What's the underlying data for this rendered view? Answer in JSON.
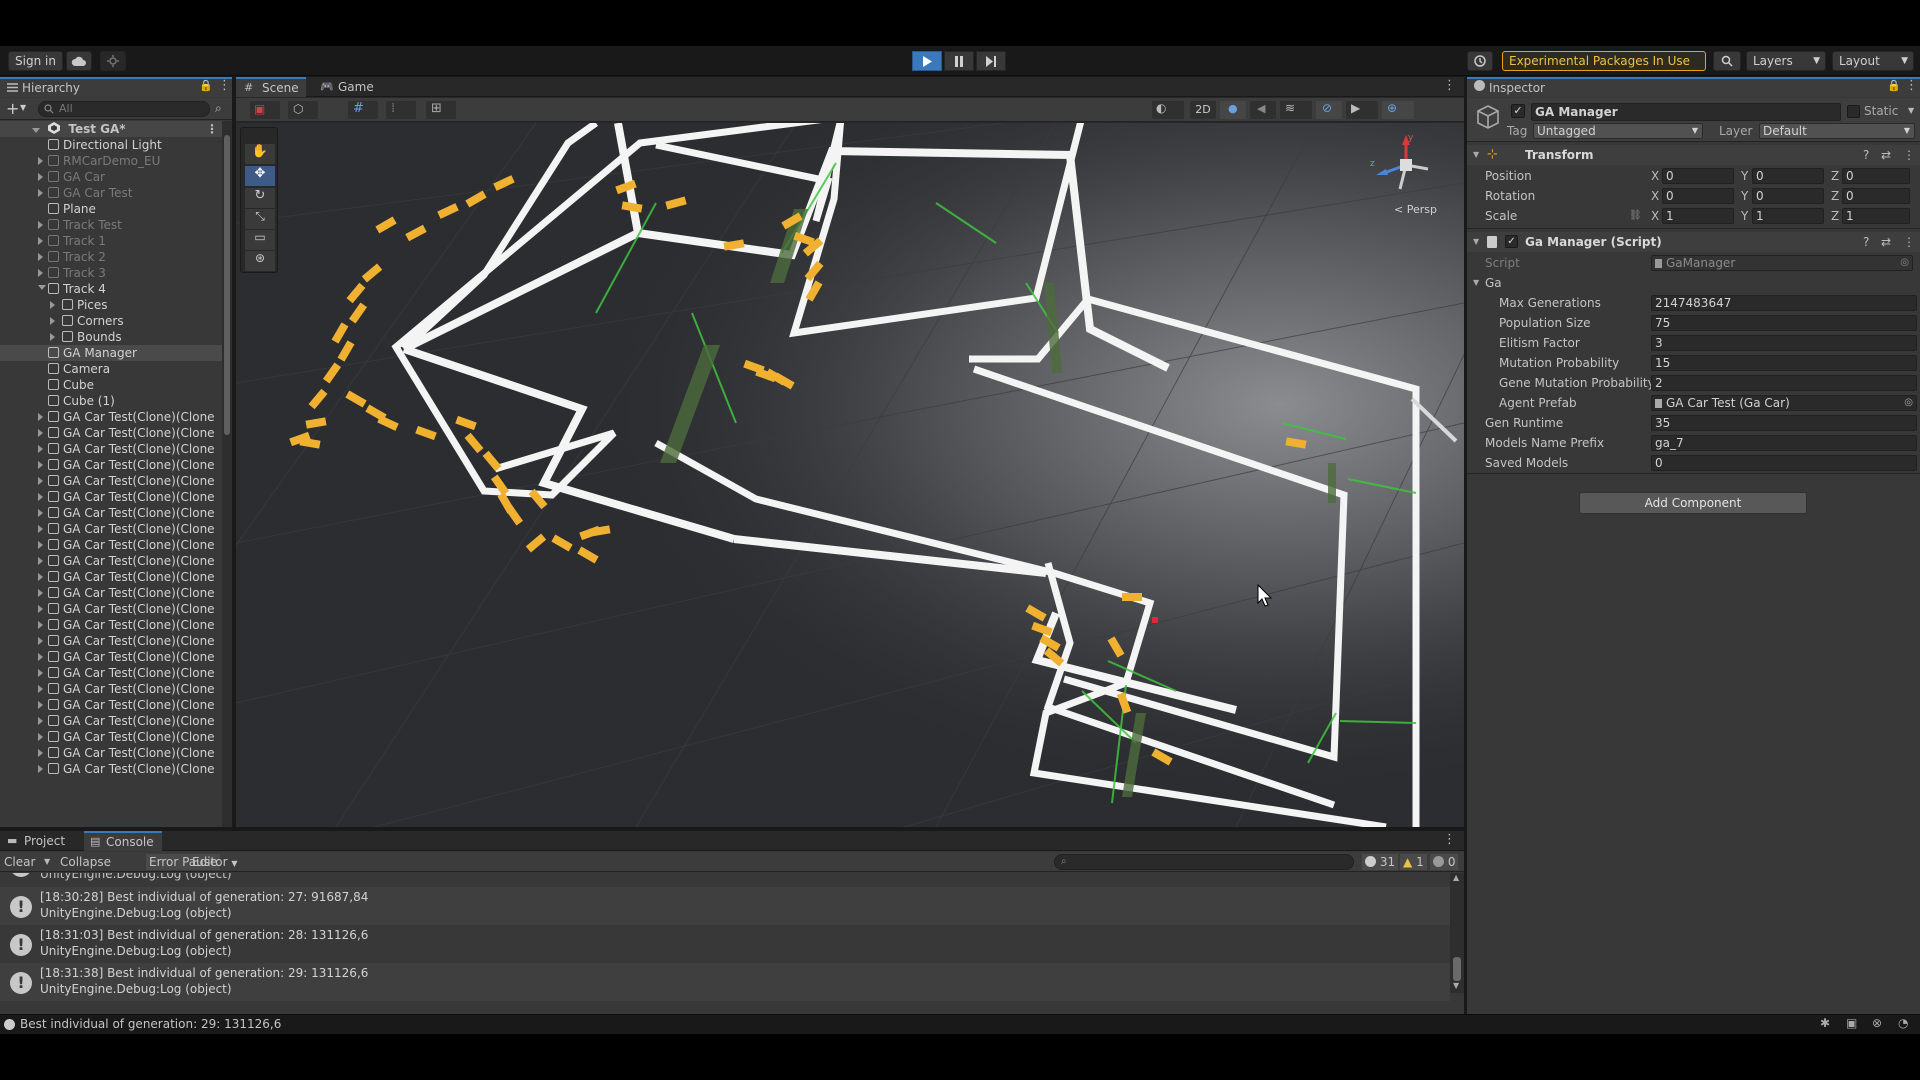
{
  "toolbar": {
    "sign_in": "Sign in",
    "experimental": "Experimental Packages In Use",
    "layers": "Layers",
    "layout": "Layout"
  },
  "hierarchy": {
    "tab": "Hierarchy",
    "search_placeholder": "All",
    "root": "Test GA*",
    "items": [
      {
        "label": "Directional Light",
        "dim": false,
        "indent": 1,
        "arrow": "none"
      },
      {
        "label": "RMCarDemo_EU",
        "dim": true,
        "indent": 1,
        "arrow": "closed"
      },
      {
        "label": "GA Car",
        "dim": true,
        "indent": 1,
        "arrow": "closed"
      },
      {
        "label": "GA Car Test",
        "dim": true,
        "indent": 1,
        "arrow": "closed"
      },
      {
        "label": "Plane",
        "dim": false,
        "indent": 1,
        "arrow": "none"
      },
      {
        "label": "Track Test",
        "dim": true,
        "indent": 1,
        "arrow": "closed"
      },
      {
        "label": "Track 1",
        "dim": true,
        "indent": 1,
        "arrow": "closed"
      },
      {
        "label": "Track 2",
        "dim": true,
        "indent": 1,
        "arrow": "closed"
      },
      {
        "label": "Track 3",
        "dim": true,
        "indent": 1,
        "arrow": "closed"
      },
      {
        "label": "Track 4",
        "dim": false,
        "indent": 1,
        "arrow": "open"
      },
      {
        "label": "Pices",
        "dim": false,
        "indent": 2,
        "arrow": "closed"
      },
      {
        "label": "Corners",
        "dim": false,
        "indent": 2,
        "arrow": "closed"
      },
      {
        "label": "Bounds",
        "dim": false,
        "indent": 2,
        "arrow": "closed"
      },
      {
        "label": "GA Manager",
        "dim": false,
        "indent": 1,
        "arrow": "none",
        "selected": true
      },
      {
        "label": "Camera",
        "dim": false,
        "indent": 1,
        "arrow": "none"
      },
      {
        "label": "Cube",
        "dim": false,
        "indent": 1,
        "arrow": "none"
      },
      {
        "label": "Cube (1)",
        "dim": false,
        "indent": 1,
        "arrow": "none"
      },
      {
        "label": "GA Car Test(Clone)(Clone",
        "dim": false,
        "indent": 1,
        "arrow": "closed"
      },
      {
        "label": "GA Car Test(Clone)(Clone",
        "dim": false,
        "indent": 1,
        "arrow": "closed"
      },
      {
        "label": "GA Car Test(Clone)(Clone",
        "dim": false,
        "indent": 1,
        "arrow": "closed"
      },
      {
        "label": "GA Car Test(Clone)(Clone",
        "dim": false,
        "indent": 1,
        "arrow": "closed"
      },
      {
        "label": "GA Car Test(Clone)(Clone",
        "dim": false,
        "indent": 1,
        "arrow": "closed"
      },
      {
        "label": "GA Car Test(Clone)(Clone",
        "dim": false,
        "indent": 1,
        "arrow": "closed"
      },
      {
        "label": "GA Car Test(Clone)(Clone",
        "dim": false,
        "indent": 1,
        "arrow": "closed"
      },
      {
        "label": "GA Car Test(Clone)(Clone",
        "dim": false,
        "indent": 1,
        "arrow": "closed"
      },
      {
        "label": "GA Car Test(Clone)(Clone",
        "dim": false,
        "indent": 1,
        "arrow": "closed"
      },
      {
        "label": "GA Car Test(Clone)(Clone",
        "dim": false,
        "indent": 1,
        "arrow": "closed"
      },
      {
        "label": "GA Car Test(Clone)(Clone",
        "dim": false,
        "indent": 1,
        "arrow": "closed"
      },
      {
        "label": "GA Car Test(Clone)(Clone",
        "dim": false,
        "indent": 1,
        "arrow": "closed"
      },
      {
        "label": "GA Car Test(Clone)(Clone",
        "dim": false,
        "indent": 1,
        "arrow": "closed"
      },
      {
        "label": "GA Car Test(Clone)(Clone",
        "dim": false,
        "indent": 1,
        "arrow": "closed"
      },
      {
        "label": "GA Car Test(Clone)(Clone",
        "dim": false,
        "indent": 1,
        "arrow": "closed"
      },
      {
        "label": "GA Car Test(Clone)(Clone",
        "dim": false,
        "indent": 1,
        "arrow": "closed"
      },
      {
        "label": "GA Car Test(Clone)(Clone",
        "dim": false,
        "indent": 1,
        "arrow": "closed"
      },
      {
        "label": "GA Car Test(Clone)(Clone",
        "dim": false,
        "indent": 1,
        "arrow": "closed"
      },
      {
        "label": "GA Car Test(Clone)(Clone",
        "dim": false,
        "indent": 1,
        "arrow": "closed"
      },
      {
        "label": "GA Car Test(Clone)(Clone",
        "dim": false,
        "indent": 1,
        "arrow": "closed"
      },
      {
        "label": "GA Car Test(Clone)(Clone",
        "dim": false,
        "indent": 1,
        "arrow": "closed"
      },
      {
        "label": "GA Car Test(Clone)(Clone",
        "dim": false,
        "indent": 1,
        "arrow": "closed"
      },
      {
        "label": "GA Car Test(Clone)(Clone",
        "dim": false,
        "indent": 1,
        "arrow": "closed"
      }
    ]
  },
  "scene": {
    "tab_scene": "Scene",
    "tab_game": "Game",
    "btn_2d": "2D",
    "gizmo_label": "Persp",
    "gizmo_y": "y",
    "gizmo_z": "z"
  },
  "inspector": {
    "tab": "Inspector",
    "object_name": "GA Manager",
    "static_label": "Static",
    "tag_label": "Tag",
    "tag_value": "Untagged",
    "layer_label": "Layer",
    "layer_value": "Default",
    "transform": {
      "title": "Transform",
      "position_label": "Position",
      "rotation_label": "Rotation",
      "scale_label": "Scale",
      "position": [
        "0",
        "0",
        "0"
      ],
      "rotation": [
        "0",
        "0",
        "0"
      ],
      "scale": [
        "1",
        "1",
        "1"
      ],
      "axis": [
        "X",
        "Y",
        "Z"
      ]
    },
    "script_component": {
      "title": "Ga Manager (Script)",
      "script_label": "Script",
      "script_value": "GaManager",
      "group_label": "Ga",
      "fields": [
        {
          "label": "Max Generations",
          "value": "2147483647"
        },
        {
          "label": "Population Size",
          "value": "75"
        },
        {
          "label": "Elitism Factor",
          "value": "3"
        },
        {
          "label": "Mutation Probability",
          "value": "15"
        },
        {
          "label": "Gene Mutation Probability",
          "value": "2"
        },
        {
          "label": "Agent Prefab",
          "value": "GA Car Test (Ga Car)"
        }
      ],
      "fields2": [
        {
          "label": "Gen Runtime",
          "value": "35"
        },
        {
          "label": "Models Name Prefix",
          "value": "ga_7"
        },
        {
          "label": "Saved Models",
          "value": "0"
        }
      ]
    },
    "add_component": "Add Component"
  },
  "console": {
    "tab_project": "Project",
    "tab_console": "Console",
    "clear": "Clear",
    "collapse": "Collapse",
    "error_pause": "Error Pause",
    "editor": "Editor",
    "count_log": "31",
    "count_warn": "1",
    "count_err": "0",
    "partial_line": "UnityEngine.Debug:Log (object)",
    "entries": [
      {
        "line1": "[18:30:28] Best individual of generation: 27: 91687,84",
        "line2": "UnityEngine.Debug:Log (object)"
      },
      {
        "line1": "[18:31:03] Best individual of generation: 28: 131126,6",
        "line2": "UnityEngine.Debug:Log (object)"
      },
      {
        "line1": "[18:31:38] Best individual of generation: 29: 131126,6",
        "line2": "UnityEngine.Debug:Log (object)"
      }
    ]
  },
  "status": {
    "message": "Best individual of generation: 29: 131126,6"
  },
  "colors": {
    "accent": "#3a79bb",
    "track_wall": "#ffffff",
    "car": "#f0b030",
    "checkpoint": "#3ec43e",
    "ground": "#2b2e33"
  }
}
